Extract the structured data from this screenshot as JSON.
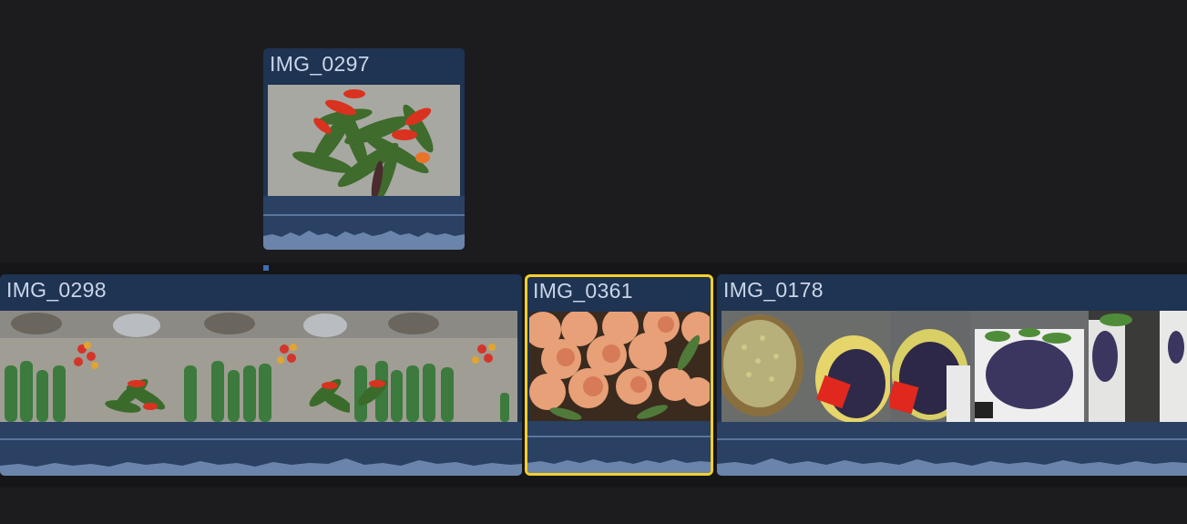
{
  "timeline": {
    "connected_clip": {
      "name": "IMG_0297",
      "thumbnail": "green and red chili peppers"
    },
    "primary_clips": [
      {
        "name": "IMG_0298",
        "thumbnail": "market vegetables: cucumbers, tomatoes, peppers",
        "selected": false
      },
      {
        "name": "IMG_0361",
        "thumbnail": "peaches",
        "selected": true
      },
      {
        "name": "IMG_0178",
        "thumbnail": "baskets of grapes and beans",
        "selected": false
      }
    ]
  },
  "colors": {
    "background": "#1c1c1e",
    "clip_fill": "#1f3352",
    "audio_fill": "#2a4164",
    "selection": "#f5cf2a"
  }
}
